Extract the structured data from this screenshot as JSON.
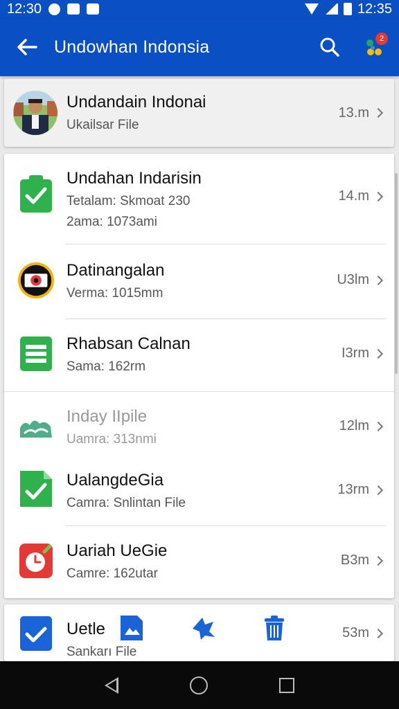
{
  "status_bar": {
    "time_left": "12:30",
    "time_right": "12:35"
  },
  "app_bar": {
    "title": "Undowhan Indonsia",
    "notification_count": "2"
  },
  "header_item": {
    "name": "Undandain Indonai",
    "sub": "Ukailsar File",
    "meta": "13.m"
  },
  "items": [
    {
      "name": "Undahan Indarisin",
      "sub": "Tetalam: Skmoat 230",
      "sub2": "2ama: 1073ami",
      "meta": "14.m"
    },
    {
      "name": "Datinangalan",
      "sub": "Verma: 1015mm",
      "meta": "U3lm"
    },
    {
      "name": "Rhabsan Calnan",
      "sub": "Sama: 162rm",
      "meta": "I3rm"
    },
    {
      "name": "Inday IIpile",
      "sub": "Uamra: 313nmi",
      "meta": "12lm"
    },
    {
      "name": "UalangdeGia",
      "sub": "Camra: Snlintan File",
      "meta": "13rm"
    },
    {
      "name": "Uariah UeGie",
      "sub": "Camre: 162utar",
      "meta": "B3m"
    }
  ],
  "bottom_item": {
    "name": "Uetle",
    "sub": "Sankarı File",
    "meta": "53m"
  },
  "colors": {
    "app_bar": "#0b4fc4",
    "green_icon": "#2fb24c",
    "red_icon": "#e53935",
    "blue_icon": "#1a63d8"
  }
}
